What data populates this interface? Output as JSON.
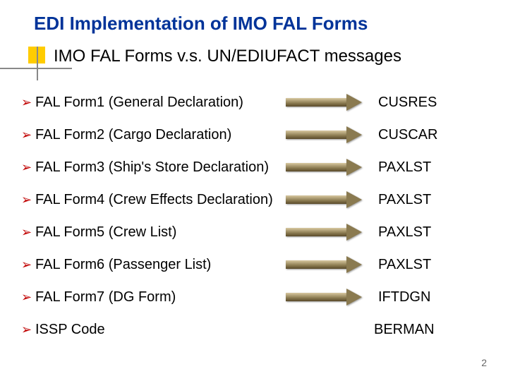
{
  "title": "EDI Implementation of IMO FAL Forms",
  "subtitle": "IMO FAL Forms v.s. UN/EDIUFACT messages",
  "bullet_char": "➢",
  "items": [
    {
      "label": "FAL Form1 (General Declaration)",
      "arrow": true,
      "message": "CUSRES"
    },
    {
      "label": "FAL Form2 (Cargo Declaration)",
      "arrow": true,
      "message": "CUSCAR"
    },
    {
      "label": "FAL Form3 (Ship's Store Declaration)",
      "arrow": true,
      "message": "PAXLST"
    },
    {
      "label": "FAL Form4 (Crew Effects Declaration)",
      "arrow": true,
      "message": "PAXLST"
    },
    {
      "label": "FAL Form5 (Crew List)",
      "arrow": true,
      "message": "PAXLST"
    },
    {
      "label": "FAL Form6 (Passenger List)",
      "arrow": true,
      "message": "PAXLST"
    },
    {
      "label": "FAL Form7 (DG Form)",
      "arrow": true,
      "message": "IFTDGN"
    },
    {
      "label": "ISSP Code",
      "arrow": false,
      "message": "BERMAN"
    }
  ],
  "page_number": "2"
}
